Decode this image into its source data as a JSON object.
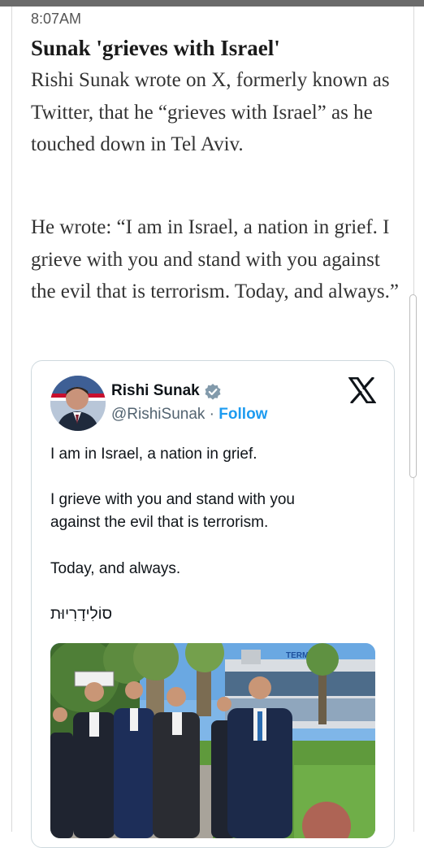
{
  "entry": {
    "time": "8:07AM",
    "headline": "Sunak 'grieves with Israel'",
    "paragraphs": [
      "Rishi Sunak wrote on X, formerly known as Twitter, that he “grieves with Israel” as he touched down in Tel Aviv.",
      "He wrote: “I am in Israel, a nation in grief. I grieve with you and stand with you against the evil that is terrorism. Today, and always.”"
    ]
  },
  "tweet": {
    "author_name": "Rishi Sunak",
    "handle": "@RishiSunak",
    "separator": " · ",
    "follow_label": "Follow",
    "lines": [
      "I am in Israel, a nation in grief.",
      "I grieve with you and stand with you\nagainst the evil that is terrorism.",
      "Today, and always.",
      "סוֹלִידָרִיוּת"
    ],
    "photo_sign": "TERMINAL 1"
  },
  "colors": {
    "link": "#1d9bf0",
    "verified": "#829aab",
    "handle": "#536471"
  }
}
